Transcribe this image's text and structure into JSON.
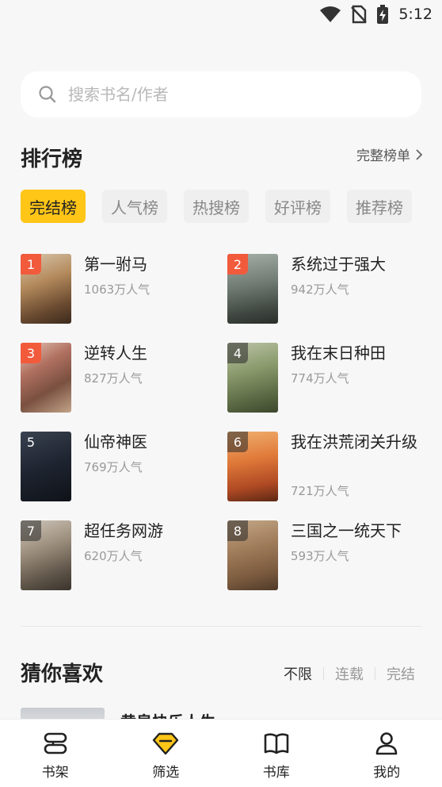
{
  "status": {
    "time": "5:12"
  },
  "search": {
    "placeholder": "搜索书名/作者"
  },
  "ranking": {
    "title": "排行榜",
    "full_list_label": "完整榜单",
    "tabs": [
      "完结榜",
      "人气榜",
      "热搜榜",
      "好评榜",
      "推荐榜"
    ],
    "books": [
      {
        "rank": "1",
        "title": "第一驸马",
        "popularity": "1063万人气"
      },
      {
        "rank": "2",
        "title": "系统过于强大",
        "popularity": "942万人气"
      },
      {
        "rank": "3",
        "title": "逆转人生",
        "popularity": "827万人气"
      },
      {
        "rank": "4",
        "title": "我在末日种田",
        "popularity": "774万人气"
      },
      {
        "rank": "5",
        "title": "仙帝神医",
        "popularity": "769万人气"
      },
      {
        "rank": "6",
        "title": "我在洪荒闭关升级",
        "popularity": "721万人气"
      },
      {
        "rank": "7",
        "title": "超任务网游",
        "popularity": "620万人气"
      },
      {
        "rank": "8",
        "title": "三国之一统天下",
        "popularity": "593万人气"
      }
    ]
  },
  "guess": {
    "title": "猜你喜欢",
    "filters": [
      "不限",
      "连载",
      "完结"
    ],
    "first_title": "黄泉快乐人生"
  },
  "nav": [
    "书架",
    "筛选",
    "书库",
    "我的"
  ],
  "colors": {
    "accent": "#ffc517",
    "rank_top": "#f25a3c"
  }
}
